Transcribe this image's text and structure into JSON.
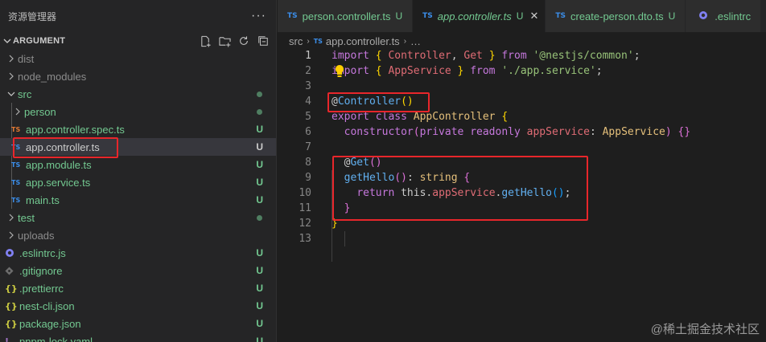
{
  "sidebar": {
    "title": "资源管理器",
    "more": "···",
    "section": "ARGUMENT",
    "items": [
      {
        "label": "dist",
        "kind": "folder",
        "open": false,
        "depth": 0,
        "icon": "chevron-right-icon"
      },
      {
        "label": "node_modules",
        "kind": "folder",
        "open": false,
        "depth": 0,
        "icon": "chevron-right-icon"
      },
      {
        "label": "src",
        "kind": "folder",
        "open": true,
        "depth": 0,
        "icon": "chevron-down-icon"
      },
      {
        "label": "person",
        "kind": "folder",
        "open": false,
        "depth": 1,
        "icon": "chevron-right-icon"
      },
      {
        "label": "app.controller.spec.ts",
        "badge": "U",
        "ft": "TS",
        "depth": 1
      },
      {
        "label": "app.controller.ts",
        "badge": "U",
        "ft": "TS",
        "depth": 1
      },
      {
        "label": "app.module.ts",
        "badge": "U",
        "ft": "TS",
        "depth": 1
      },
      {
        "label": "app.service.ts",
        "badge": "U",
        "ft": "TS",
        "depth": 1
      },
      {
        "label": "main.ts",
        "badge": "U",
        "ft": "TS",
        "depth": 1
      },
      {
        "label": "test",
        "kind": "folder",
        "open": false,
        "depth": 0
      },
      {
        "label": "uploads",
        "kind": "folder",
        "open": false,
        "depth": 0
      },
      {
        "label": ".eslintrc.js",
        "badge": "U",
        "depth": 0
      },
      {
        "label": ".gitignore",
        "badge": "U",
        "depth": 0
      },
      {
        "label": ".prettierrc",
        "badge": "U",
        "depth": 0
      },
      {
        "label": "nest-cli.json",
        "badge": "U",
        "depth": 0
      },
      {
        "label": "package.json",
        "badge": "U",
        "depth": 0
      },
      {
        "label": "pnpm-lock.yaml",
        "badge": "U",
        "depth": 0
      }
    ]
  },
  "tabs": [
    {
      "ft": "TS",
      "label": "person.controller.ts",
      "badge": "U"
    },
    {
      "ft": "TS",
      "label": "app.controller.ts",
      "badge": "U",
      "close": "✕"
    },
    {
      "ft": "TS",
      "label": "create-person.dto.ts",
      "badge": "U"
    },
    {
      "label": ".eslintrc"
    }
  ],
  "breadcrumb": {
    "root": "src",
    "sep": "›",
    "ft": "TS",
    "file": "app.controller.ts",
    "tail": "…"
  },
  "line_numbers": [
    "1",
    "2",
    "3",
    "4",
    "5",
    "6",
    "7",
    "8",
    "9",
    "10",
    "11",
    "12",
    "13"
  ],
  "code": {
    "l1": {
      "import": "import",
      "ob": "{",
      "a": " Controller",
      "comma": ",",
      "b": " Get ",
      "cb": "}",
      "from": " from ",
      "path": "'@nestjs/common'",
      "semi": ";"
    },
    "l2": {
      "import": "import",
      "ob": "{",
      "a": " AppService ",
      "cb": "}",
      "from": " from ",
      "path": "'./app.service'",
      "semi": ";"
    },
    "l4": {
      "at": "@",
      "dec": "Controller",
      "paren": "()"
    },
    "l5": {
      "export": "export",
      "class": " class ",
      "name": "AppController",
      "ob": " {"
    },
    "l6": {
      "ctor": "constructor",
      "op": "(",
      "priv": "private",
      "ro": " readonly ",
      "param": "appService",
      "colon": ": ",
      "type": "AppService",
      "cp": ")",
      "body": " {}"
    },
    "l8": {
      "at": "@",
      "dec": "Get",
      "paren": "()"
    },
    "l9": {
      "method": "getHello",
      "parens": "()",
      "colon": ": ",
      "type": "string",
      "ob": " {"
    },
    "l10": {
      "ret": "return",
      "this": " this",
      "dot": ".",
      "svc": "appService",
      "dot2": ".",
      "call": "getHello",
      "parens": "()",
      "semi": ";"
    },
    "l11": {
      "cb": "}"
    },
    "l12": {
      "cb": "}"
    }
  },
  "watermark": "@稀土掘金技术社区"
}
